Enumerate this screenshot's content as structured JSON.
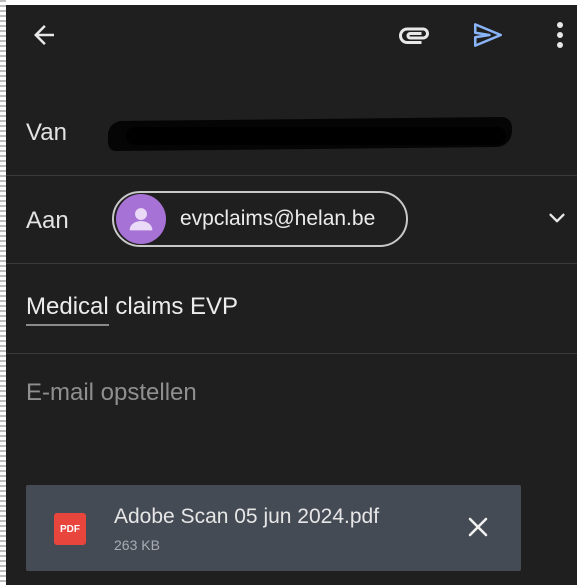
{
  "toolbar": {
    "back_icon": "arrow-left-icon",
    "attach_icon": "paperclip-icon",
    "send_icon": "send-icon",
    "more_icon": "more-vert-icon",
    "send_color": "#8ab4f8"
  },
  "from": {
    "label": "Van"
  },
  "to": {
    "label": "Aan",
    "recipient": "evpclaims@helan.be",
    "avatar_color": "#a772d6",
    "expand_icon": "chevron-down-icon"
  },
  "subject": {
    "word1": "Medical",
    "rest": " claims EVP"
  },
  "body": {
    "placeholder": "E-mail opstellen"
  },
  "attachment": {
    "type_label": "PDF",
    "file_name": "Adobe Scan 05 jun 2024.pdf",
    "file_size": "263 KB",
    "remove_icon": "close-icon"
  }
}
